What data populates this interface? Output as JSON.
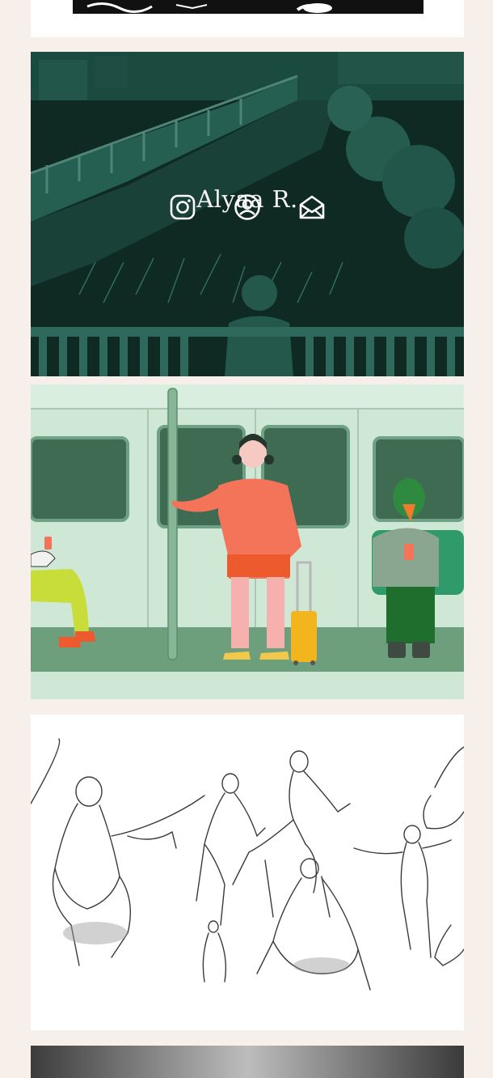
{
  "profile": {
    "name": "Alyaa R."
  },
  "links": [
    {
      "icon": "instagram-icon"
    },
    {
      "icon": "user-circle-icon"
    },
    {
      "icon": "mail-open-icon"
    }
  ],
  "gallery": [
    {
      "name": "landscape-illustration",
      "palette": "teal-dark"
    },
    {
      "name": "subway-illustration",
      "palette": "mint-green"
    },
    {
      "name": "figure-sketches",
      "palette": "pencil-gray"
    }
  ],
  "colors": {
    "page_bg": "#f6efea",
    "hero_tint": "#144b3e",
    "train_bg": "#cfe8d6",
    "accent_coral": "#f4745a"
  }
}
